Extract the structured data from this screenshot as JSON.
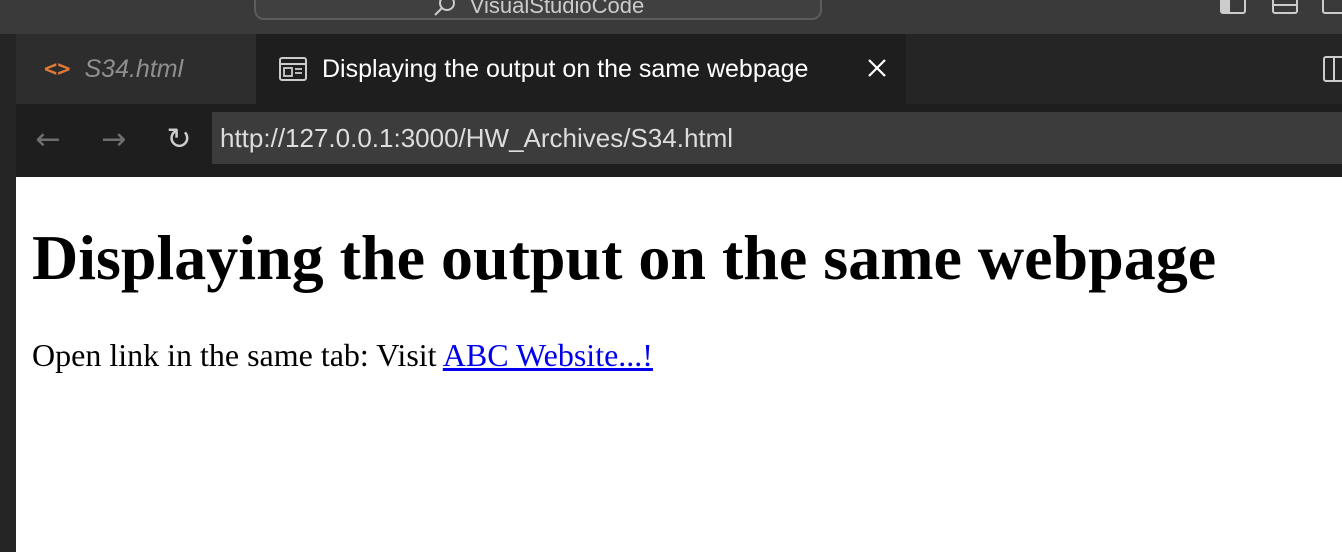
{
  "titlebar": {
    "command_center_text": "VisualStudioCode"
  },
  "tabs": [
    {
      "label": "S34.html",
      "icon": "code-icon",
      "active": false
    },
    {
      "label": "Displaying the output on the same webpage",
      "icon": "preview-icon",
      "active": true
    }
  ],
  "nav": {
    "url": "http://127.0.0.1:3000/HW_Archives/S34.html"
  },
  "page": {
    "heading": "Displaying the output on the same webpage",
    "paragraph_text": "Open link in the same tab: Visit ",
    "link_text": "ABC Website...!"
  },
  "colors": {
    "accent_code_icon": "#e37933",
    "link": "#0000ee"
  }
}
